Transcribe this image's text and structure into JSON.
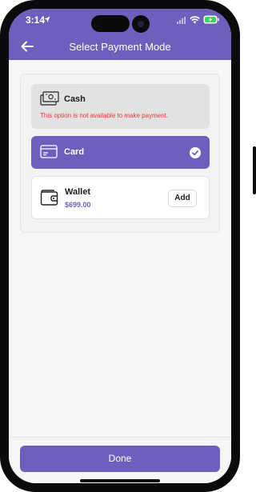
{
  "status_bar": {
    "time": "3:14",
    "signal_icon": "cellular-signal-icon",
    "wifi_icon": "wifi-icon",
    "battery_icon": "battery-charging-icon"
  },
  "header": {
    "title": "Select Payment Mode",
    "back_icon": "back-arrow-icon"
  },
  "payment_options": {
    "cash": {
      "label": "Cash",
      "note": "This option is not available to make payment.",
      "icon": "cash-icon",
      "available": false
    },
    "card": {
      "label": "Card",
      "icon": "card-icon",
      "selected": true
    },
    "wallet": {
      "label": "Wallet",
      "amount": "$699.00",
      "icon": "wallet-icon",
      "add_label": "Add"
    }
  },
  "footer": {
    "done_label": "Done"
  },
  "colors": {
    "accent": "#6d5fbb",
    "error": "#e53935",
    "disabled_bg": "#e2e2e2"
  }
}
